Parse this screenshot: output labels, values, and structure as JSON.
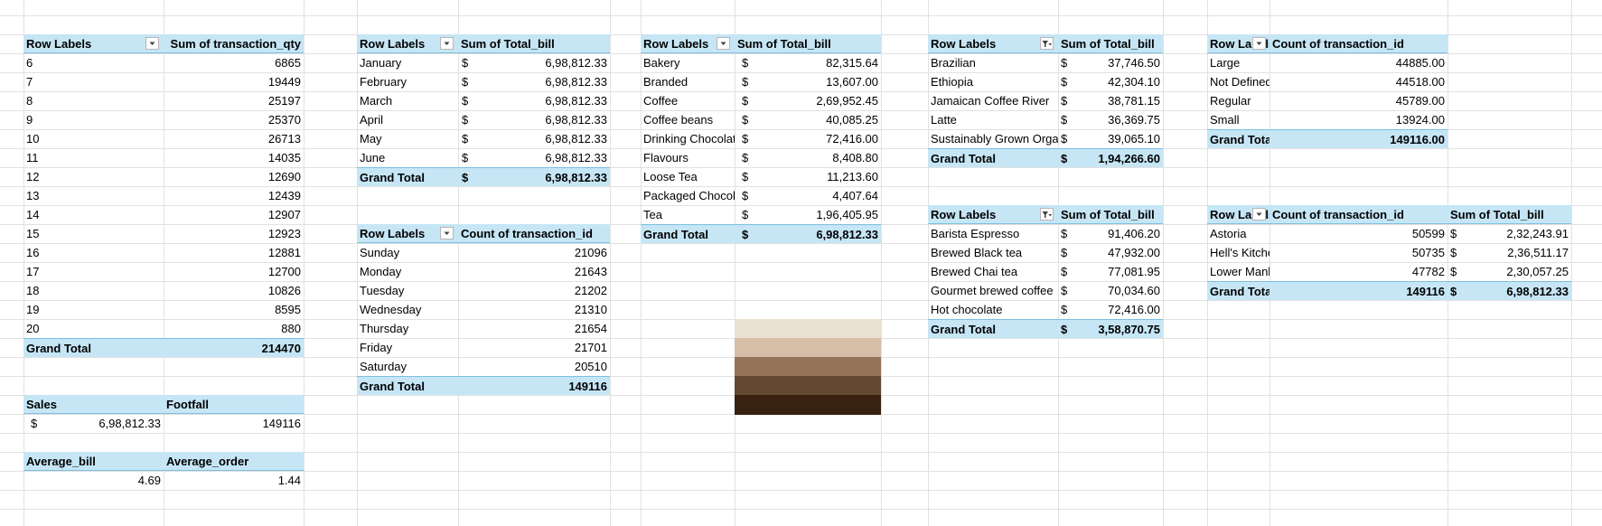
{
  "pivot_hour": {
    "header": [
      "Row Labels",
      "Sum of transaction_qty"
    ],
    "rows": [
      [
        "6",
        "6865"
      ],
      [
        "7",
        "19449"
      ],
      [
        "8",
        "25197"
      ],
      [
        "9",
        "25370"
      ],
      [
        "10",
        "26713"
      ],
      [
        "11",
        "14035"
      ],
      [
        "12",
        "12690"
      ],
      [
        "13",
        "12439"
      ],
      [
        "14",
        "12907"
      ],
      [
        "15",
        "12923"
      ],
      [
        "16",
        "12881"
      ],
      [
        "17",
        "12700"
      ],
      [
        "18",
        "10826"
      ],
      [
        "19",
        "8595"
      ],
      [
        "20",
        "880"
      ]
    ],
    "total": [
      "Grand Total",
      "214470"
    ]
  },
  "kpi_sales": {
    "header": [
      "Sales",
      "Footfall"
    ],
    "currency": "$",
    "values": [
      "6,98,812.33",
      "149116"
    ]
  },
  "kpi_avg": {
    "header": [
      "Average_bill",
      "Average_order"
    ],
    "values": [
      "4.69",
      "1.44"
    ]
  },
  "pivot_month": {
    "header": [
      "Row Labels",
      "Sum of Total_bill"
    ],
    "currency": "$",
    "rows": [
      [
        "January",
        "6,98,812.33"
      ],
      [
        "February",
        "6,98,812.33"
      ],
      [
        "March",
        "6,98,812.33"
      ],
      [
        "April",
        "6,98,812.33"
      ],
      [
        "May",
        "6,98,812.33"
      ],
      [
        "June",
        "6,98,812.33"
      ]
    ],
    "total": [
      "Grand Total",
      "6,98,812.33"
    ]
  },
  "pivot_day": {
    "header": [
      "Row Labels",
      "Count of transaction_id"
    ],
    "rows": [
      [
        "Sunday",
        "21096"
      ],
      [
        "Monday",
        "21643"
      ],
      [
        "Tuesday",
        "21202"
      ],
      [
        "Wednesday",
        "21310"
      ],
      [
        "Thursday",
        "21654"
      ],
      [
        "Friday",
        "21701"
      ],
      [
        "Saturday",
        "20510"
      ]
    ],
    "total": [
      "Grand Total",
      "149116"
    ]
  },
  "pivot_category": {
    "header": [
      "Row Labels",
      "Sum of Total_bill"
    ],
    "currency": "$",
    "rows": [
      [
        "Bakery",
        "82,315.64"
      ],
      [
        "Branded",
        "13,607.00"
      ],
      [
        "Coffee",
        "2,69,952.45"
      ],
      [
        "Coffee beans",
        "40,085.25"
      ],
      [
        "Drinking Chocolate",
        "72,416.00"
      ],
      [
        "Flavours",
        "8,408.80"
      ],
      [
        "Loose Tea",
        "11,213.60"
      ],
      [
        "Packaged Chocolate",
        "4,407.64"
      ],
      [
        "Tea",
        "1,96,405.95"
      ]
    ],
    "total": [
      "Grand Total",
      "6,98,812.33"
    ]
  },
  "palette": {
    "colors": [
      "#eae0d2",
      "#d7bea8",
      "#967259",
      "#634832",
      "#38220f"
    ]
  },
  "pivot_origin": {
    "header": [
      "Row Labels",
      "Sum of Total_bill"
    ],
    "currency": "$",
    "rows": [
      [
        "Brazilian",
        "37,746.50"
      ],
      [
        "Ethiopia",
        "42,304.10"
      ],
      [
        "Jamaican Coffee River",
        "38,781.15"
      ],
      [
        "Latte",
        "36,369.75"
      ],
      [
        "Sustainably Grown Organic",
        "39,065.10"
      ]
    ],
    "total": [
      "Grand Total",
      "1,94,266.60"
    ]
  },
  "pivot_product": {
    "header": [
      "Row Labels",
      "Sum of Total_bill"
    ],
    "currency": "$",
    "rows": [
      [
        "Barista Espresso",
        "91,406.20"
      ],
      [
        "Brewed Black tea",
        "47,932.00"
      ],
      [
        "Brewed Chai tea",
        "77,081.95"
      ],
      [
        "Gourmet brewed coffee",
        "70,034.60"
      ],
      [
        "Hot chocolate",
        "72,416.00"
      ]
    ],
    "total": [
      "Grand Total",
      "3,58,870.75"
    ]
  },
  "pivot_size": {
    "header": [
      "Row Labels",
      "Count of transaction_id"
    ],
    "rows": [
      [
        "Large",
        "44885.00"
      ],
      [
        "Not Defined",
        "44518.00"
      ],
      [
        "Regular",
        "45789.00"
      ],
      [
        "Small",
        "13924.00"
      ]
    ],
    "total": [
      "Grand Total",
      "149116.00"
    ]
  },
  "pivot_store": {
    "header": [
      "Row Labels",
      "Count of transaction_id",
      "Sum of Total_bill"
    ],
    "currency": "$",
    "rows": [
      [
        "Astoria",
        "50599",
        "2,32,243.91"
      ],
      [
        "Hell's Kitchen",
        "50735",
        "2,36,511.17"
      ],
      [
        "Lower Manhattan",
        "47782",
        "2,30,057.25"
      ]
    ],
    "total": [
      "Grand Total",
      "149116",
      "6,98,812.33"
    ]
  }
}
